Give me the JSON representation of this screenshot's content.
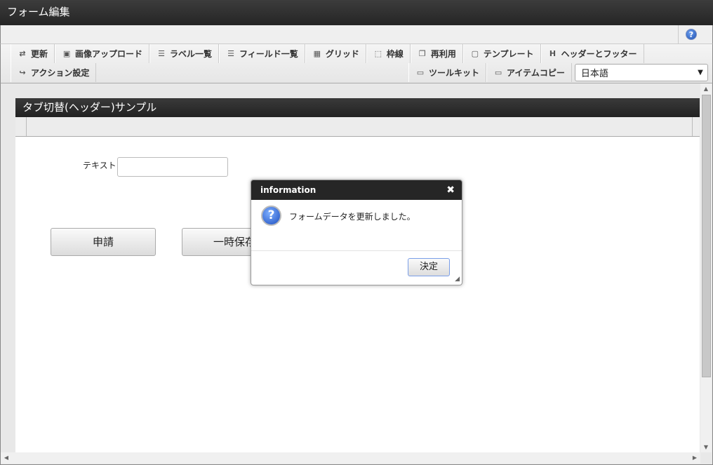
{
  "window": {
    "title": "フォーム編集"
  },
  "toolbar": {
    "row1": [
      {
        "label": "更新",
        "icon": "update-icon",
        "glyph": "⇄"
      },
      {
        "label": "画像アップロード",
        "icon": "image-upload-icon",
        "glyph": "▣"
      },
      {
        "label": "ラベル一覧",
        "icon": "label-list-icon",
        "glyph": "☰"
      },
      {
        "label": "フィールド一覧",
        "icon": "field-list-icon",
        "glyph": "☰"
      },
      {
        "label": "グリッド",
        "icon": "grid-icon",
        "glyph": "▦"
      },
      {
        "label": "枠線",
        "icon": "border-icon",
        "glyph": "⬚"
      },
      {
        "label": "再利用",
        "icon": "reuse-icon",
        "glyph": "❐"
      },
      {
        "label": "テンプレート",
        "icon": "template-icon",
        "glyph": "▢"
      },
      {
        "label": "ヘッダーとフッター",
        "icon": "header-footer-icon",
        "glyph": "H"
      }
    ],
    "row2": [
      {
        "label": "アクション設定",
        "icon": "action-settings-icon",
        "glyph": "↪"
      }
    ],
    "row2_right": [
      {
        "label": "ツールキット",
        "icon": "toolkit-icon",
        "glyph": "▭"
      },
      {
        "label": "アイテムコピー",
        "icon": "item-copy-icon",
        "glyph": "▭"
      }
    ],
    "language": "日本語"
  },
  "form": {
    "title": "タブ切替(ヘッダー)サンプル",
    "text_label": "テキスト",
    "text_value": "",
    "apply_button": "申請",
    "save_button": "一時保存"
  },
  "dialog": {
    "title": "information",
    "message": "フォームデータを更新しました。",
    "ok_button": "決定"
  }
}
